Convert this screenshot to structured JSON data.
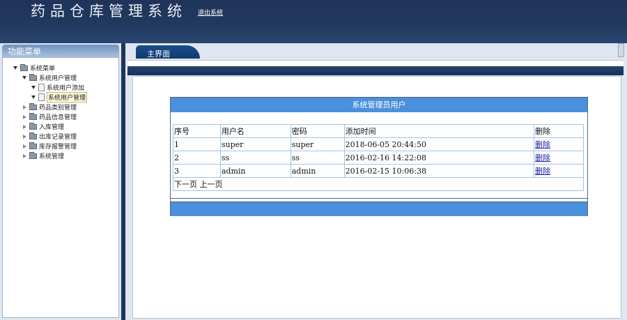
{
  "header": {
    "app_title": "药品仓库管理系统",
    "logout_label": "退出系统"
  },
  "sidebar": {
    "title": "功能菜单",
    "tree": {
      "root": "系统菜单",
      "user_mgmt": "系统用户管理",
      "user_add": "系统用户添加",
      "user_manage": "系统用户管理",
      "drug_category": "药品类别管理",
      "drug_info": "药品信息管理",
      "stock_in": "入库管理",
      "stock_out_records": "出库记录管理",
      "stock_alert": "库存报警管理",
      "system_mgmt": "系统管理"
    }
  },
  "main": {
    "tab_label": "主界面",
    "box_title": "系统管理员用户",
    "columns": [
      "序号",
      "用户名",
      "密码",
      "添加时间",
      "删除"
    ],
    "rows": [
      {
        "id": "1",
        "username": "super",
        "password": "super",
        "added": "2018-06-05 20:44:50",
        "action": "删除"
      },
      {
        "id": "2",
        "username": "ss",
        "password": "ss",
        "added": "2016-02-16 14:22:08",
        "action": "删除"
      },
      {
        "id": "3",
        "username": "admin",
        "password": "admin",
        "added": "2016-02-15 10:06:38",
        "action": "删除"
      }
    ],
    "pager": {
      "next": "下一页",
      "prev": "上一页"
    }
  },
  "colors": {
    "header_bg": "#1f3458",
    "accent_blue": "#4a90dd",
    "table_border": "#9ec3e6",
    "link": "#1a1aa8"
  }
}
